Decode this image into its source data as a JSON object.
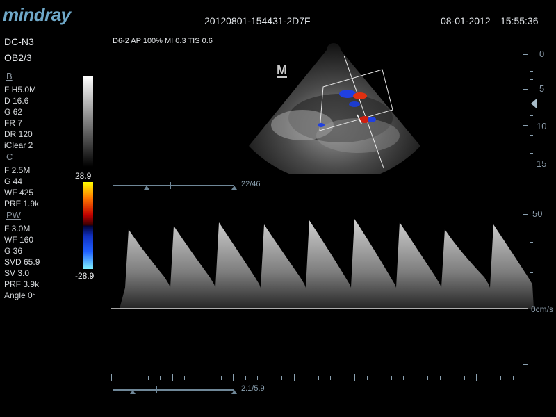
{
  "header": {
    "brand": "mindray",
    "exam_id": "20120801-154431-2D7F",
    "date": "08-01-2012",
    "time": "15:55:36"
  },
  "left_panel": {
    "probe": "DC-N3",
    "preset": "OB2/3",
    "b_mode": {
      "title": "B",
      "params": [
        "F H5.0M",
        "D 16.6",
        "G 62",
        "FR 7",
        "DR 120",
        "iClear 2"
      ]
    },
    "c_mode": {
      "title": "C",
      "params": [
        "F 2.5M",
        "G 44",
        "WF 425",
        "PRF 1.9k"
      ]
    },
    "pw_mode": {
      "title": "PW",
      "params": [
        "F 3.0M",
        "WF 160",
        "G 36",
        "SVD 65.9",
        "SV 3.0",
        "PRF 3.9k",
        "Angle 0°"
      ]
    },
    "color_scale": {
      "max": "28.9",
      "min": "-28.9"
    }
  },
  "image_params": "D6-2  AP 100%  MI 0.3  TIS 0.6",
  "marker": "M",
  "depth_scale": [
    "0",
    "5",
    "10",
    "15"
  ],
  "velocity_scale": {
    "top": "50",
    "baseline": "0cm/s"
  },
  "slider_top": {
    "value": "22/46",
    "fill_fraction": 0.48
  },
  "slider_bottom": {
    "value": "2.1/5.9",
    "fill_fraction": 0.36
  },
  "colors": {
    "scale_blue": "#8aa0b0",
    "brand": "#6fa8c8"
  }
}
